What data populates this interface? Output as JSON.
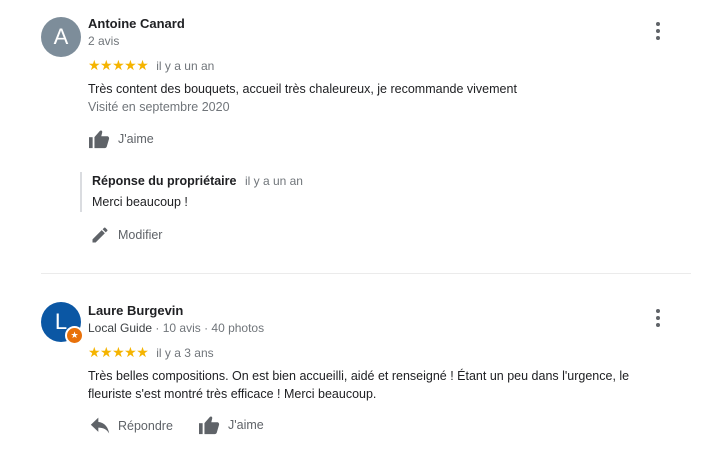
{
  "reviews": [
    {
      "avatar_letter": "A",
      "name": "Antoine Canard",
      "meta": "2 avis",
      "stars": "★★★★★",
      "time": "il y a un an",
      "text": "Très content des bouquets, accueil très chaleureux, je recommande vivement",
      "visited": "Visité en septembre 2020",
      "like_label": "J'aime",
      "owner_response": {
        "title": "Réponse du propriétaire",
        "time": "il y a un an",
        "text": "Merci beaucoup !"
      },
      "edit_label": "Modifier"
    },
    {
      "avatar_letter": "L",
      "name": "Laure Burgevin",
      "local_guide": "Local Guide",
      "meta": " · 10 avis · 40 photos",
      "stars": "★★★★★",
      "time": "il y a 3 ans",
      "text": "Très belles compositions. On est bien accueilli, aidé et renseigné ! Étant un peu dans l'urgence, le fleuriste s'est montré très efficace ! Merci beaucoup.",
      "reply_label": "Répondre",
      "like_label": "J'aime"
    }
  ],
  "colors": {
    "star": "#f5b400",
    "avatar_grey": "#7d8d9a",
    "avatar_blue": "#0b57a4",
    "guide_badge": "#e8710a"
  },
  "icons": [
    "more-vert-icon",
    "thumb-up-icon",
    "pencil-icon",
    "reply-icon",
    "local-guide-star-icon"
  ]
}
